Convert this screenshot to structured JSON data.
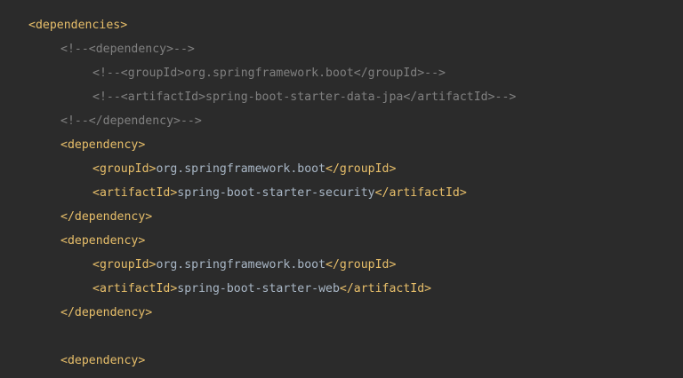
{
  "editor": {
    "colors": {
      "background": "#2b2b2b",
      "tag": "#e8bf6a",
      "text": "#a9b7c6",
      "comment": "#808080"
    },
    "lines": [
      {
        "indent": 0,
        "kind": "tag",
        "text": "<dependencies>"
      },
      {
        "indent": 1,
        "kind": "comment",
        "text": "<!--<dependency>-->"
      },
      {
        "indent": 2,
        "kind": "comment",
        "text": "<!--<groupId>org.springframework.boot</groupId>-->"
      },
      {
        "indent": 2,
        "kind": "comment",
        "text": "<!--<artifactId>spring-boot-starter-data-jpa</artifactId>-->"
      },
      {
        "indent": 1,
        "kind": "comment",
        "text": "<!--</dependency>-->"
      },
      {
        "indent": 1,
        "kind": "tag",
        "text": "<dependency>"
      },
      {
        "indent": 2,
        "kind": "element",
        "open": "<groupId>",
        "value": "org.springframework.boot",
        "close": "</groupId>"
      },
      {
        "indent": 2,
        "kind": "element",
        "open": "<artifactId>",
        "value": "spring-boot-starter-security",
        "close": "</artifactId>"
      },
      {
        "indent": 1,
        "kind": "tag",
        "text": "</dependency>"
      },
      {
        "indent": 1,
        "kind": "tag",
        "text": "<dependency>"
      },
      {
        "indent": 2,
        "kind": "element",
        "open": "<groupId>",
        "value": "org.springframework.boot",
        "close": "</groupId>"
      },
      {
        "indent": 2,
        "kind": "element",
        "open": "<artifactId>",
        "value": "spring-boot-starter-web",
        "close": "</artifactId>"
      },
      {
        "indent": 1,
        "kind": "tag",
        "text": "</dependency>"
      },
      {
        "indent": 1,
        "kind": "blank",
        "text": ""
      },
      {
        "indent": 1,
        "kind": "tag",
        "text": "<dependency>"
      }
    ]
  }
}
